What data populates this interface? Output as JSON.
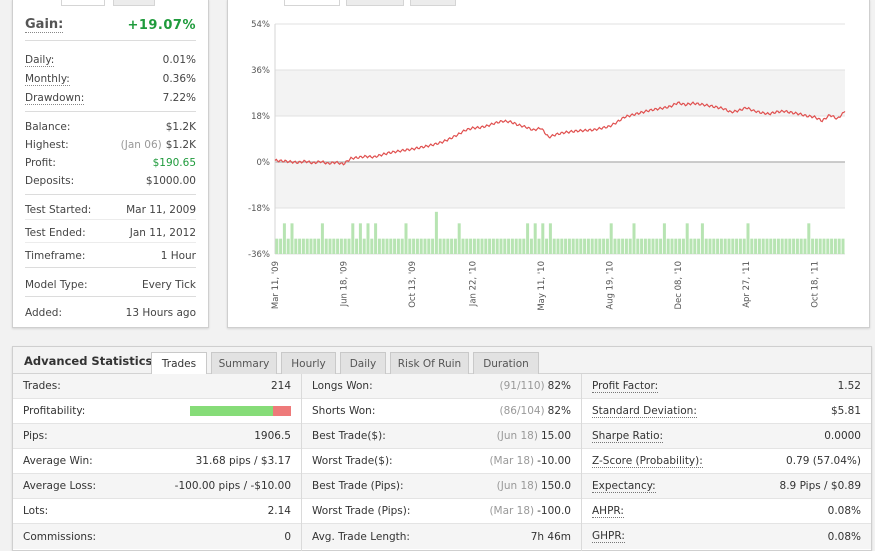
{
  "summary": {
    "gain_label": "Gain:",
    "gain_value": "+19.07%",
    "rows": [
      {
        "label": "Daily:",
        "value": "0.01%"
      },
      {
        "label": "Monthly:",
        "value": "0.36%"
      },
      {
        "label": "Drawdown:",
        "value": "7.22%"
      },
      {
        "label": "Balance:",
        "value": "$1.2K"
      },
      {
        "label": "Highest:",
        "sub": "(Jan 06)",
        "value": "$1.2K"
      },
      {
        "label": "Profit:",
        "value": "$190.65"
      },
      {
        "label": "Deposits:",
        "value": "$1000.00"
      },
      {
        "label": "Test Started:",
        "value": "Mar 11, 2009"
      },
      {
        "label": "Test Ended:",
        "value": "Jan 11, 2012"
      },
      {
        "label": "Timeframe:",
        "value": "1 Hour"
      },
      {
        "label": "Model Type:",
        "value": "Every Tick"
      },
      {
        "label": "Added:",
        "value": "13 Hours ago"
      }
    ],
    "colors": {
      "positive": "#1f9b3c"
    }
  },
  "chart_data": {
    "type": "line",
    "title": "",
    "xlabel": "",
    "ylabel": "",
    "y_tick_labels": [
      "54%",
      "36%",
      "18%",
      "0%",
      "-18%",
      "-36%"
    ],
    "y_ticks": [
      54,
      36,
      18,
      0,
      -18,
      -36
    ],
    "ylim": [
      -36,
      54
    ],
    "x_tick_labels": [
      "Mar 11, '09",
      "Jun 18, '09",
      "Oct 13, '09",
      "Jan 22, '10",
      "May 11, '10",
      "Aug 19, '10",
      "Dec 08, '10",
      "Apr 27, '11",
      "Oct 18, '11"
    ],
    "x_tick_index": [
      0,
      9,
      18,
      26,
      35,
      44,
      53,
      62,
      71
    ],
    "series": [
      {
        "type": "line",
        "color": "#e0504f",
        "values": [
          0.6,
          0.4,
          0.1,
          -0.2,
          0.3,
          -0.4,
          0.2,
          -0.6,
          -0.1,
          -0.8,
          1.4,
          1.8,
          2.2,
          1.9,
          2.8,
          3.6,
          4.1,
          4.6,
          5.0,
          5.6,
          6.2,
          6.9,
          7.8,
          9.1,
          10.6,
          12.4,
          13.3,
          13.5,
          14.2,
          15.3,
          16.0,
          15.7,
          14.5,
          13.7,
          12.5,
          13.3,
          9.7,
          10.8,
          11.5,
          11.9,
          12.2,
          12.4,
          12.6,
          13.3,
          13.9,
          15.6,
          17.6,
          18.4,
          19.2,
          20.0,
          20.6,
          21.1,
          21.7,
          23.2,
          22.4,
          23.0,
          22.6,
          22.1,
          21.5,
          20.9,
          19.5,
          20.1,
          21.3,
          20.0,
          19.3,
          18.8,
          19.6,
          19.9,
          19.3,
          18.8,
          18.0,
          17.6,
          16.1,
          18.4,
          16.9,
          19.8
        ]
      },
      {
        "type": "bar",
        "color": "#b7e4b2",
        "baseline": -36,
        "base_level": -30,
        "spikes": [
          {
            "index": 1,
            "value": -24
          },
          {
            "index": 2,
            "value": -24
          },
          {
            "index": 6,
            "value": -24
          },
          {
            "index": 10,
            "value": -24
          },
          {
            "index": 11,
            "value": -24
          },
          {
            "index": 12,
            "value": -24
          },
          {
            "index": 13,
            "value": -24
          },
          {
            "index": 17,
            "value": -24
          },
          {
            "index": 21,
            "value": -19.5
          },
          {
            "index": 24,
            "value": -24
          },
          {
            "index": 33,
            "value": -24
          },
          {
            "index": 34,
            "value": -24
          },
          {
            "index": 35,
            "value": -24
          },
          {
            "index": 36,
            "value": -24
          },
          {
            "index": 44,
            "value": -24
          },
          {
            "index": 47,
            "value": -24
          },
          {
            "index": 51,
            "value": -24
          },
          {
            "index": 54,
            "value": -24
          },
          {
            "index": 56,
            "value": -24
          },
          {
            "index": 62,
            "value": -24
          },
          {
            "index": 70,
            "value": -24
          }
        ]
      }
    ],
    "grid": true,
    "legend": "none"
  },
  "advanced": {
    "title": "Advanced Statistics",
    "tabs": [
      {
        "label": "Trades",
        "active": true
      },
      {
        "label": "Summary",
        "active": false
      },
      {
        "label": "Hourly",
        "active": false
      },
      {
        "label": "Daily",
        "active": false
      },
      {
        "label": "Risk Of Ruin",
        "active": false
      },
      {
        "label": "Duration",
        "active": false
      }
    ],
    "col1": [
      {
        "label": "Trades:",
        "value": "214"
      },
      {
        "label": "Profitability:",
        "won_fraction": 0.82
      },
      {
        "label": "Pips:",
        "value": "1906.5"
      },
      {
        "label": "Average Win:",
        "value": "31.68 pips / $3.17"
      },
      {
        "label": "Average Loss:",
        "value": "-100.00 pips / -$10.00"
      },
      {
        "label": "Lots:",
        "value": "2.14"
      },
      {
        "label": "Commissions:",
        "value": "0"
      }
    ],
    "col2": [
      {
        "label": "Longs Won:",
        "sub": "(91/110)",
        "value": "82%"
      },
      {
        "label": "Shorts Won:",
        "sub": "(86/104)",
        "value": "82%"
      },
      {
        "label": "Best Trade($):",
        "sub": "(Jun 18)",
        "value": "15.00"
      },
      {
        "label": "Worst Trade($):",
        "sub": "(Mar 18)",
        "value": "-10.00"
      },
      {
        "label": "Best Trade (Pips):",
        "sub": "(Jun 18)",
        "value": "150.0"
      },
      {
        "label": "Worst Trade (Pips):",
        "sub": "(Mar 18)",
        "value": "-100.0"
      },
      {
        "label": "Avg. Trade Length:",
        "value": "7h 46m"
      }
    ],
    "col3": [
      {
        "label": "Profit Factor:",
        "value": "1.52"
      },
      {
        "label": "Standard Deviation:",
        "value": "$5.81"
      },
      {
        "label": "Sharpe Ratio:",
        "value": "0.0000"
      },
      {
        "label": "Z-Score (Probability):",
        "value": "0.79 (57.04%)"
      },
      {
        "label": "Expectancy:",
        "value": "8.9 Pips / $0.89"
      },
      {
        "label": "AHPR:",
        "value": "0.08%"
      },
      {
        "label": "GHPR:",
        "value": "0.08%"
      }
    ]
  }
}
